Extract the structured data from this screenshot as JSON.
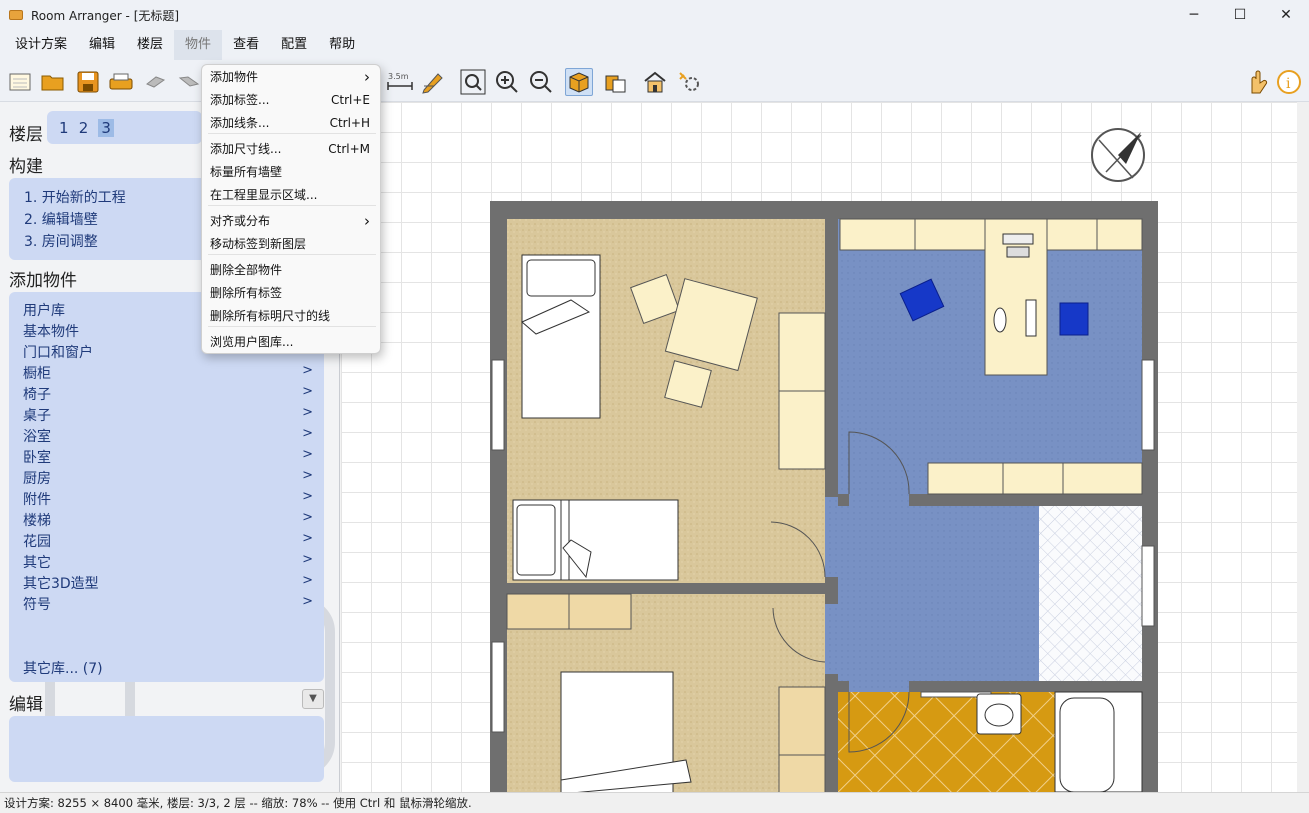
{
  "window": {
    "title": "Room Arranger - [无标题]",
    "minimize": "─",
    "maximize": "☐",
    "close": "✕"
  },
  "menubar": {
    "items": [
      "设计方案",
      "编辑",
      "楼层",
      "物件",
      "查看",
      "配置",
      "帮助"
    ],
    "active_index": 3
  },
  "toolbar": {
    "icons": [
      "new-icon",
      "open-icon",
      "save-icon",
      "print-icon",
      "undo-icon",
      "redo-icon",
      "measure-icon",
      "pencil-icon",
      "zoom-fit-icon",
      "zoom-in-icon",
      "zoom-out-icon",
      "3d-box-icon",
      "3d-multi-icon",
      "house-icon",
      "settings-icon",
      "hand-icon",
      "info-icon"
    ],
    "measure_label": "3.5m"
  },
  "dropdown": {
    "items": [
      {
        "label": "添加物件",
        "shortcut": "",
        "submenu": true
      },
      {
        "label": "添加标签...",
        "shortcut": "Ctrl+E",
        "submenu": false
      },
      {
        "label": "添加线条...",
        "shortcut": "Ctrl+H",
        "submenu": false
      },
      {
        "label": "添加尺寸线...",
        "shortcut": "Ctrl+M",
        "submenu": false
      },
      {
        "label": "标量所有墙壁",
        "shortcut": "",
        "submenu": false
      },
      {
        "label": "在工程里显示区域...",
        "shortcut": "",
        "submenu": false
      },
      {
        "label": "对齐或分布",
        "shortcut": "",
        "submenu": true
      },
      {
        "label": "移动标签到新图层",
        "shortcut": "",
        "submenu": false
      },
      {
        "label": "删除全部物件",
        "shortcut": "",
        "submenu": false
      },
      {
        "label": "删除所有标签",
        "shortcut": "",
        "submenu": false
      },
      {
        "label": "删除所有标明尺寸的线",
        "shortcut": "",
        "submenu": false
      },
      {
        "label": "浏览用户图库...",
        "shortcut": "",
        "submenu": false
      }
    ]
  },
  "left_panel": {
    "floors_title": "楼层",
    "floors": [
      "1",
      "2",
      "3"
    ],
    "selected_floor": "3",
    "build_title": "构建",
    "build_steps": [
      "1. 开始新的工程",
      "2. 编辑墙壁",
      "3. 房间调整"
    ],
    "add_objects_title": "添加物件",
    "object_categories": [
      "用户库",
      "基本物件",
      "门口和窗户",
      "橱柜",
      "椅子",
      "桌子",
      "浴室",
      "卧室",
      "厨房",
      "附件",
      "楼梯",
      "花园",
      "其它",
      "其它3D造型",
      "符号"
    ],
    "arrow_from_index": 3,
    "arrow_glyph": ">",
    "other_libraries": "其它库... (7)",
    "edit_title": "编辑",
    "edit_toggle": "▼"
  },
  "status_bar": {
    "text": "设计方案: 8255 × 8400 毫米, 楼层: 3/3, 2 层 -- 缩放: 78% -- 使用 Ctrl 和 鼠标滑轮缩放."
  },
  "colors": {
    "wall": "#6f6f6f",
    "carpet": "#d9c79b",
    "blue_floor": "#7891c4",
    "tile_floor": "#d69a12",
    "furniture": "#fbf1c9",
    "chair_blue": "#1638c8",
    "panel_box": "#cdd9f3"
  }
}
